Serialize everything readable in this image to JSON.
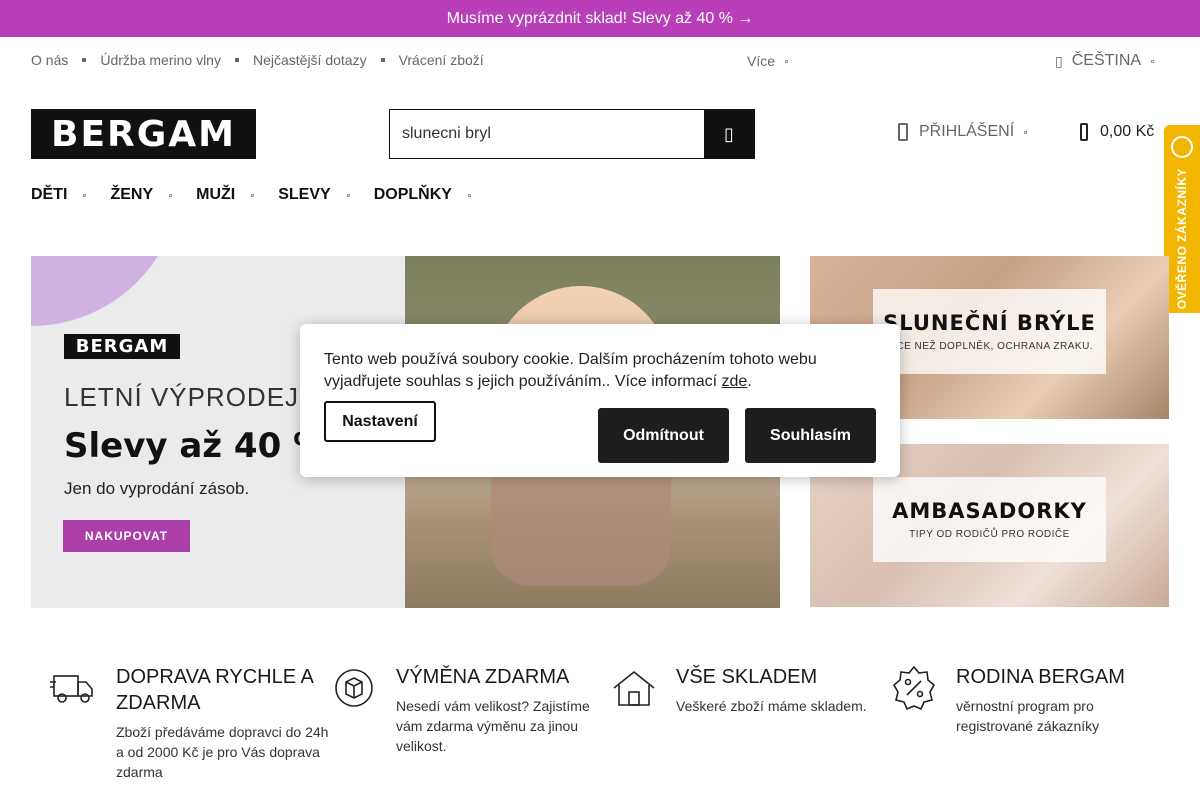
{
  "promo": {
    "text": "Musíme vyprázdnit sklad! Slevy až 40 % →"
  },
  "top_links": [
    "O nás",
    "Údržba merino vlny",
    "Nejčastější dotazy",
    "Vrácení zboží"
  ],
  "top_more": "Více",
  "language": {
    "label": "ČEŠTINA",
    "icon": "globe-icon"
  },
  "logo": {
    "text": "BERGAM"
  },
  "search": {
    "value": "slunecni bryl",
    "button_icon": "search-icon"
  },
  "account": {
    "label": "PŘIHLÁŠENÍ",
    "icon": "user-icon"
  },
  "cart": {
    "total": "0,00 Kč",
    "icon": "cart-icon"
  },
  "trust_badge": {
    "text": "OVĚŘENO ZÁKAZNÍKY",
    "color": "#f2b600"
  },
  "main_nav": [
    "DĚTI",
    "ŽENY",
    "MUŽI",
    "SLEVY",
    "DOPLŇKY"
  ],
  "hero": {
    "logo": "BERGAM",
    "title": "LETNÍ VÝPRODEJ",
    "headline": "Slevy až 40 %",
    "subtitle": "Jen do vyprodání zásob.",
    "button": "NAKUPOVAT",
    "accent": "#ac3ea8"
  },
  "side_banners": [
    {
      "title": "SLUNEČNÍ BRÝLE",
      "subtitle": "VÍCE NEŽ DOPLNĚK, OCHRANA ZRAKU."
    },
    {
      "title": "AMBASADORKY",
      "subtitle": "TIPY OD RODIČŮ PRO RODIČE"
    }
  ],
  "cookie": {
    "text": "Tento web používá soubory cookie. Dalším procházením tohoto webu vyjadřujete souhlas s jejich používáním.. Více informací",
    "link": "zde",
    "settings": "Nastavení",
    "decline": "Odmítnout",
    "accept": "Souhlasím"
  },
  "benefits": [
    {
      "icon": "truck-icon",
      "title": "DOPRAVA RYCHLE A ZDARMA",
      "text": "Zboží předáváme dopravci do 24h a od 2000 Kč je pro Vás doprava zdarma"
    },
    {
      "icon": "box-exchange-icon",
      "title": "VÝMĚNA ZDARMA",
      "text": "Nesedí vám velikost? Zajistíme vám zdarma výměnu za jinou velikost."
    },
    {
      "icon": "house-icon",
      "title": "VŠE SKLADEM",
      "text": "Veškeré zboží máme skladem."
    },
    {
      "icon": "percent-badge-icon",
      "title": "RODINA BERGAM",
      "text": "věrnostní program pro registrované zákazníky"
    }
  ]
}
